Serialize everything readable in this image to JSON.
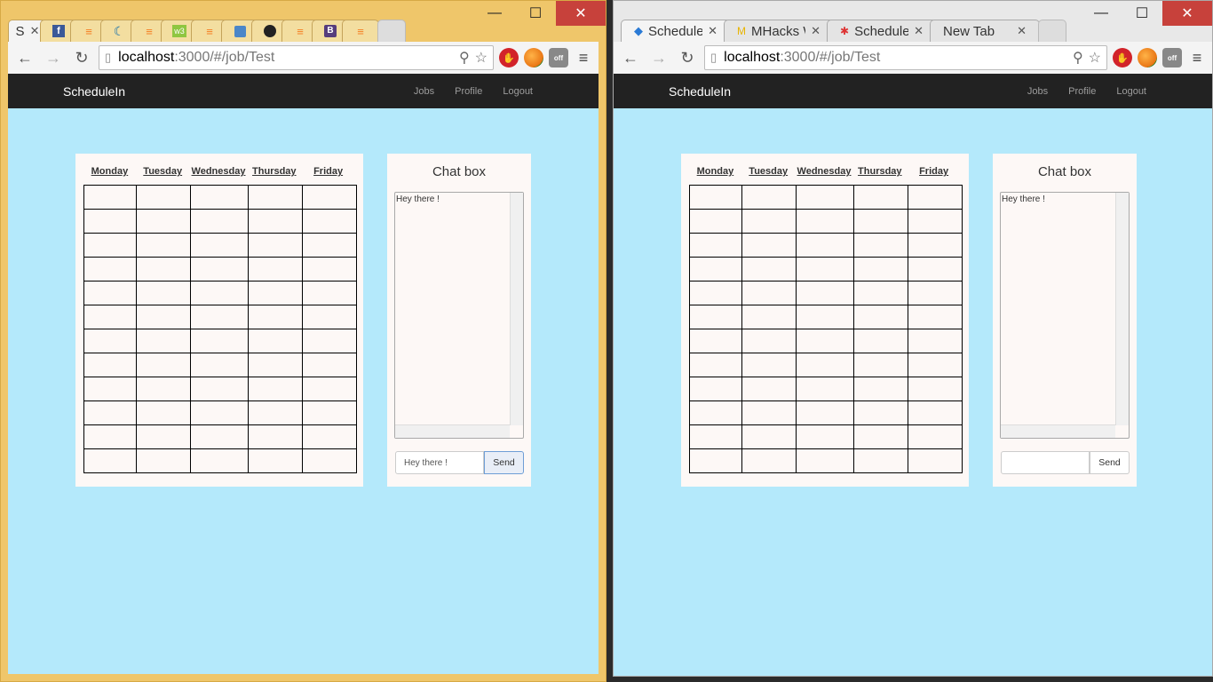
{
  "left_window": {
    "tabs": [
      {
        "label": "S",
        "icon": "page-icon",
        "active": true
      },
      {
        "label": "",
        "icon": "facebook-icon"
      },
      {
        "label": "",
        "icon": "stackoverflow-icon"
      },
      {
        "label": "",
        "icon": "jquery-icon"
      },
      {
        "label": "",
        "icon": "stackoverflow-icon"
      },
      {
        "label": "",
        "icon": "w3schools-icon"
      },
      {
        "label": "",
        "icon": "stackoverflow-icon"
      },
      {
        "label": "",
        "icon": "chat-icon"
      },
      {
        "label": "",
        "icon": "github-icon"
      },
      {
        "label": "",
        "icon": "stackoverflow-icon"
      },
      {
        "label": "",
        "icon": "bootstrap-icon"
      },
      {
        "label": "",
        "icon": "stackoverflow-icon"
      }
    ],
    "url_host": "localhost",
    "url_path": ":3000/#/job/Test",
    "chat_input_value": "Hey there !"
  },
  "right_window": {
    "tabs": [
      {
        "label": "ScheduleIn",
        "icon": "page-icon",
        "active": true
      },
      {
        "label": "MHacks W",
        "icon": "mhacks-icon"
      },
      {
        "label": "ScheduleIn",
        "icon": "puzzle-icon"
      },
      {
        "label": "New Tab",
        "icon": ""
      }
    ],
    "url_host": "localhost",
    "url_path": ":3000/#/job/Test",
    "chat_input_value": ""
  },
  "app": {
    "brand": "ScheduleIn",
    "nav": [
      "Jobs",
      "Profile",
      "Logout"
    ],
    "days": [
      "Monday",
      "Tuesday",
      "Wednesday",
      "Thursday",
      "Friday"
    ],
    "grid_rows": 12,
    "chat_title": "Chat box",
    "chat_messages": [
      "Hey there !"
    ],
    "send_label": "Send"
  },
  "window_controls": {
    "minimize": "—",
    "maximize": "☐",
    "close": "✕"
  },
  "colors": {
    "page_bg": "#b4e9fb",
    "navbar_bg": "#222222",
    "card_bg": "#fdf8f6",
    "left_frame": "#efc66a"
  }
}
